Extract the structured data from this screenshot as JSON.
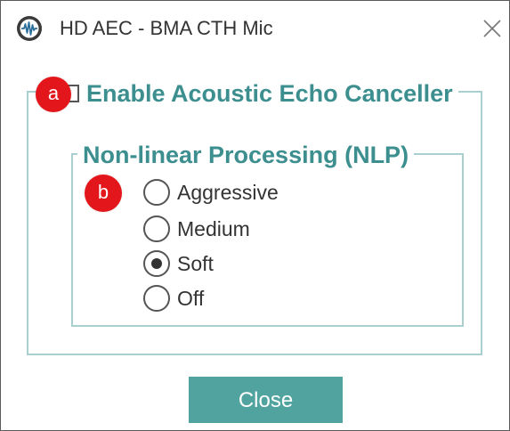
{
  "window": {
    "title": "HD AEC - BMA CTH Mic",
    "app_icon": "hd-aec-app-icon",
    "close_icon": "close-icon"
  },
  "aec_group": {
    "legend": "Enable Acoustic Echo Canceller",
    "checkbox_checked": false
  },
  "nlp_group": {
    "legend": "Non-linear Processing (NLP)",
    "options": [
      {
        "label": "Aggressive",
        "checked": false
      },
      {
        "label": "Medium",
        "checked": false
      },
      {
        "label": "Soft",
        "checked": true
      },
      {
        "label": "Off",
        "checked": false
      }
    ]
  },
  "callouts": {
    "a": "a",
    "b": "b"
  },
  "footer": {
    "close_label": "Close"
  },
  "colors": {
    "accent_text": "#3d8f8f",
    "group_border": "#a9cfcf",
    "button_bg": "#51a39f",
    "callout_bg": "#e3161b"
  }
}
